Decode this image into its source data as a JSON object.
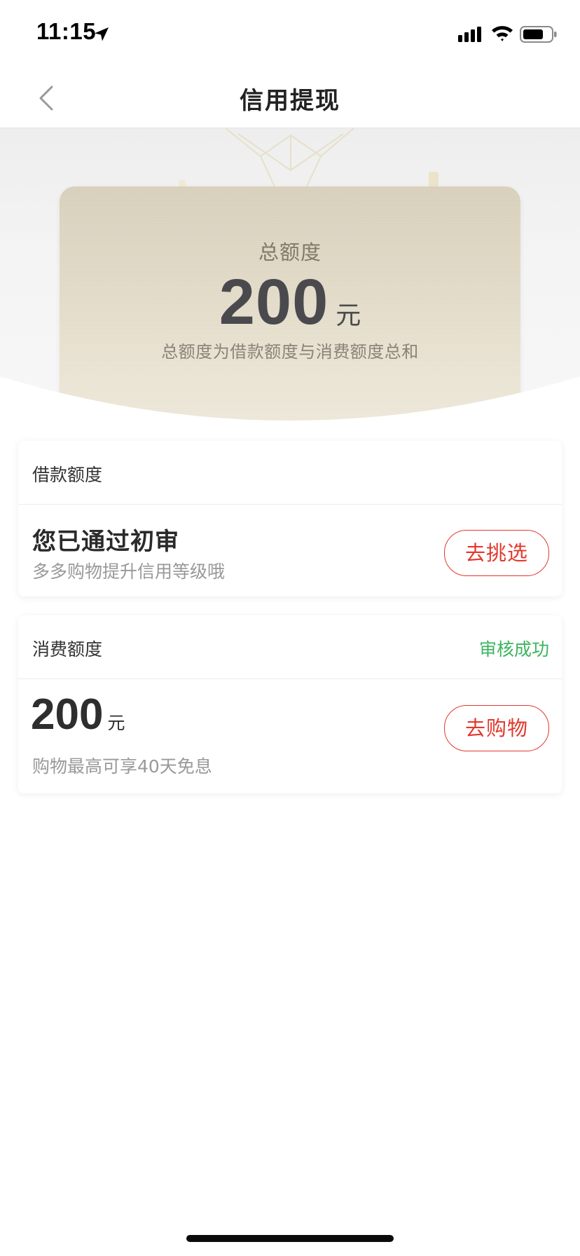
{
  "status_bar": {
    "time": "11:15",
    "icons": [
      "location-arrow-icon",
      "signal-icon",
      "wifi-icon",
      "battery-icon"
    ]
  },
  "nav": {
    "back_icon": "chevron-left-icon",
    "title": "信用提现"
  },
  "hero": {
    "label": "总额度",
    "amount": "200",
    "unit": "元",
    "description": "总额度为借款额度与消费额度总和"
  },
  "loan_card": {
    "header_title": "借款额度",
    "main_title": "您已通过初审",
    "subtitle": "多多购物提升信用等级哦",
    "button_label": "去挑选"
  },
  "consumption_card": {
    "header_title": "消费额度",
    "status": "审核成功",
    "amount": "200",
    "unit": "元",
    "subtitle": "购物最高可享40天免息",
    "button_label": "去购物"
  },
  "colors": {
    "accent_red": "#e2382e",
    "success_green": "#3bb55e",
    "card_gold": "#e3dcc9",
    "text_dark": "#333333",
    "text_gray": "#999999"
  }
}
